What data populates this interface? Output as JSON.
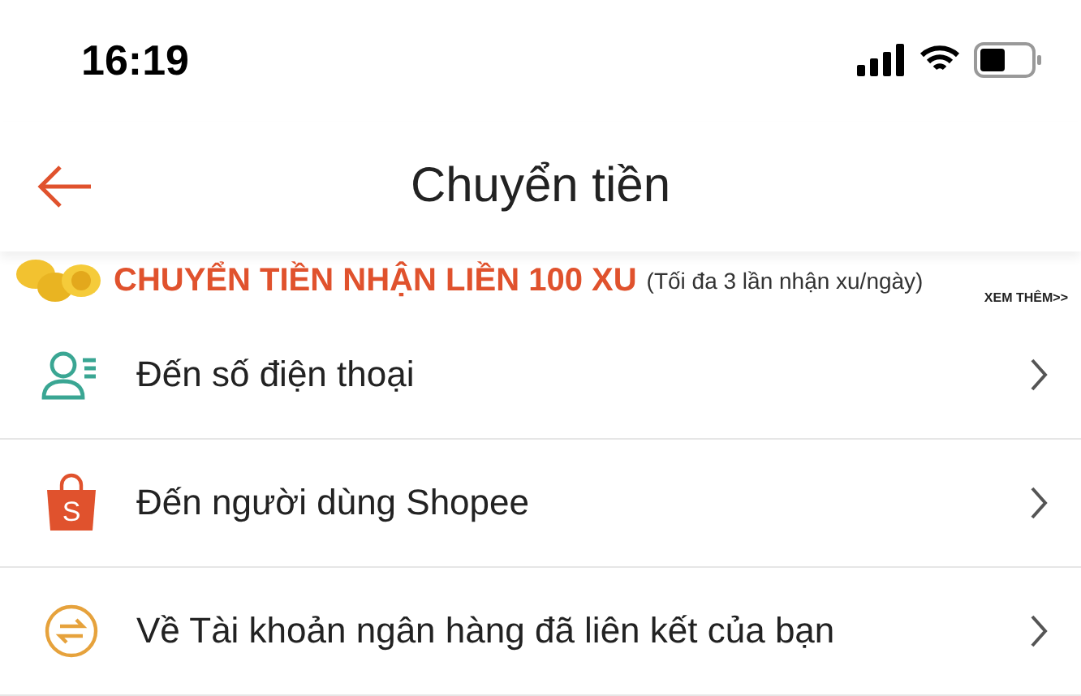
{
  "status_bar": {
    "time": "16:19"
  },
  "header": {
    "title": "Chuyển tiền"
  },
  "promo": {
    "headline": "CHUYỂN TIỀN NHẬN LIỀN 100 XU",
    "note": "(Tối đa 3 lần nhận xu/ngày)",
    "link": "XEM THÊM>>"
  },
  "options": [
    {
      "kind": "phone",
      "label": "Đến số điện thoại"
    },
    {
      "kind": "shopee",
      "label": "Đến người dùng Shopee",
      "icon_letter": "S"
    },
    {
      "kind": "bank",
      "label": "Về Tài khoản ngân hàng đã liên kết của bạn"
    }
  ]
}
